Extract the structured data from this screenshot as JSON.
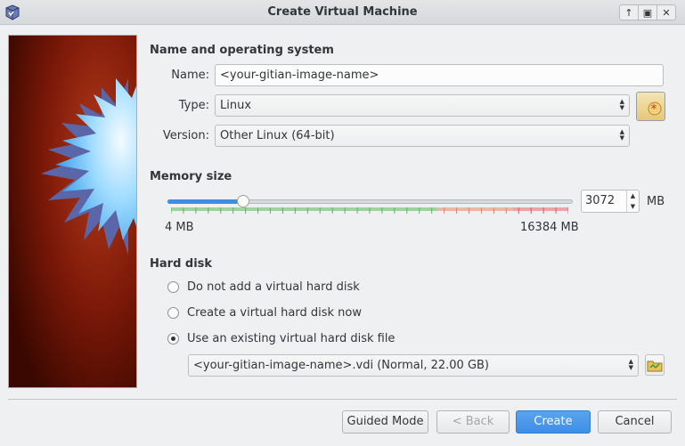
{
  "window": {
    "title": "Create Virtual Machine",
    "buttons": [
      "keep-above",
      "restore",
      "close"
    ]
  },
  "name_os": {
    "section_title": "Name and operating system",
    "name_label": "Name:",
    "name_value": "<your-gitian-image-name>",
    "type_label": "Type:",
    "type_value": "Linux",
    "version_label": "Version:",
    "version_value": "Other Linux (64-bit)"
  },
  "memory": {
    "section_title": "Memory size",
    "min_label": "4 MB",
    "max_label": "16384 MB",
    "min_mb": 4,
    "max_mb": 16384,
    "value": "3072",
    "unit": "MB"
  },
  "hard_disk": {
    "section_title": "Hard disk",
    "options": [
      {
        "label": "Do not add a virtual hard disk",
        "selected": false
      },
      {
        "label": "Create a virtual hard disk now",
        "selected": false
      },
      {
        "label": "Use an existing virtual hard disk file",
        "selected": true
      }
    ],
    "existing_file": "<your-gitian-image-name>.vdi (Normal, 22.00 GB)"
  },
  "footer": {
    "guided_mode": "Guided Mode",
    "back": "< Back",
    "create": "Create",
    "cancel": "Cancel"
  },
  "colors": {
    "accent": "#3d8ee5",
    "banner_red": "#8a1a0a"
  }
}
